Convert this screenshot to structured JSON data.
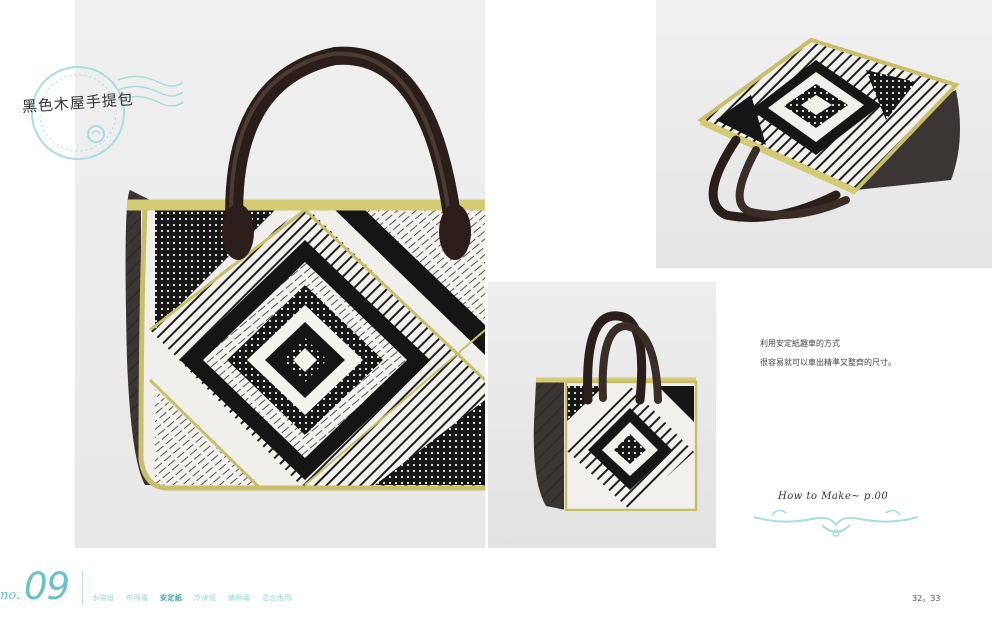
{
  "title": "黑色木屋手提包",
  "description": [
    "利用安定紙趣車的方式",
    "很容易就可以車出精準又整齊的尺寸。"
  ],
  "how_to_make": "How to Make~ p.00",
  "number": {
    "prefix": "no.",
    "value": "09"
  },
  "categories": [
    "水溶紙",
    "布用襯",
    "安定紙",
    "冷凍紙",
    "鋪棉襯",
    "混合應用"
  ],
  "active_category": "安定紙",
  "pages": {
    "left": "32",
    "sep": "。",
    "right": "33"
  },
  "colors": {
    "accent": "#69c2c7",
    "accent_dark": "#3fa6ad",
    "piping": "#c9bf6a",
    "handle": "#2b1e1a"
  },
  "images": [
    {
      "name": "main-bag-photo",
      "subject": "black and white log-cabin quilted handbag, front view"
    },
    {
      "name": "top-bag-photo",
      "subject": "handbag viewed from above at an angle"
    },
    {
      "name": "small-bag-photo",
      "subject": "handbag, three-quarter view"
    }
  ]
}
